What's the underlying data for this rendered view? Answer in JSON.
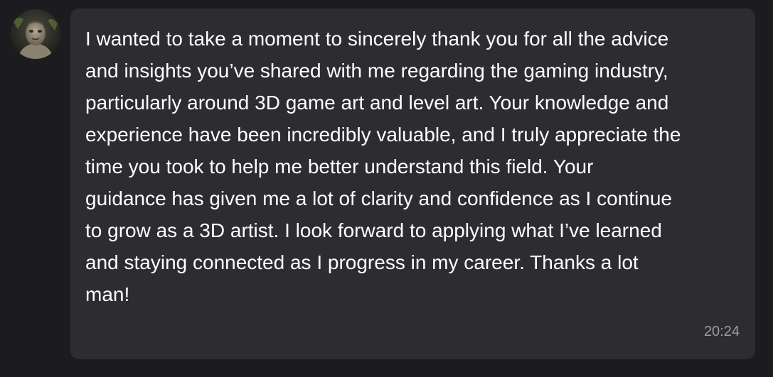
{
  "message": {
    "avatar_icon": "character-avatar-icon",
    "text": "I wanted to take a moment to sincerely thank you for all the advice\nand insights you’ve shared with me regarding the gaming industry,\nparticularly around 3D game art and level art. Your knowledge and\nexperience have been incredibly valuable, and I truly appreciate the\ntime you took to help me better understand this field. Your\nguidance has given me a lot of clarity and confidence as I continue\nto grow as a 3D artist. I look forward to applying what I’ve learned\nand staying connected as I progress in my career. Thanks a lot\nman!",
    "time": "20:24"
  },
  "colors": {
    "background": "#1c1c20",
    "bubble": "#2c2c31",
    "text": "#ffffff",
    "timestamp": "#9b9ba1"
  }
}
